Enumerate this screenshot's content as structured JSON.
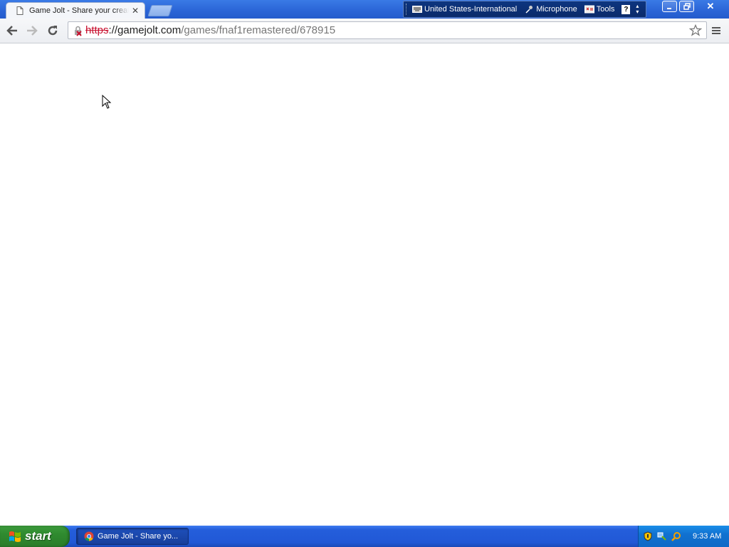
{
  "browser": {
    "tab": {
      "title": "Game Jolt - Share your creations"
    },
    "url": {
      "scheme": "https",
      "host": "://gamejolt.com",
      "path": "/games/fnaf1remastered/678915"
    }
  },
  "language_bar": {
    "language": "United States-International",
    "microphone": "Microphone",
    "tools": "Tools",
    "help": "?"
  },
  "taskbar": {
    "start_label": "start",
    "task_label": "Game Jolt - Share yo...",
    "clock": "9:33 AM"
  },
  "colors": {
    "insecure_scheme": "#c8102e",
    "taskbar_blue": "#245edb",
    "start_green": "#2f8a2f"
  }
}
